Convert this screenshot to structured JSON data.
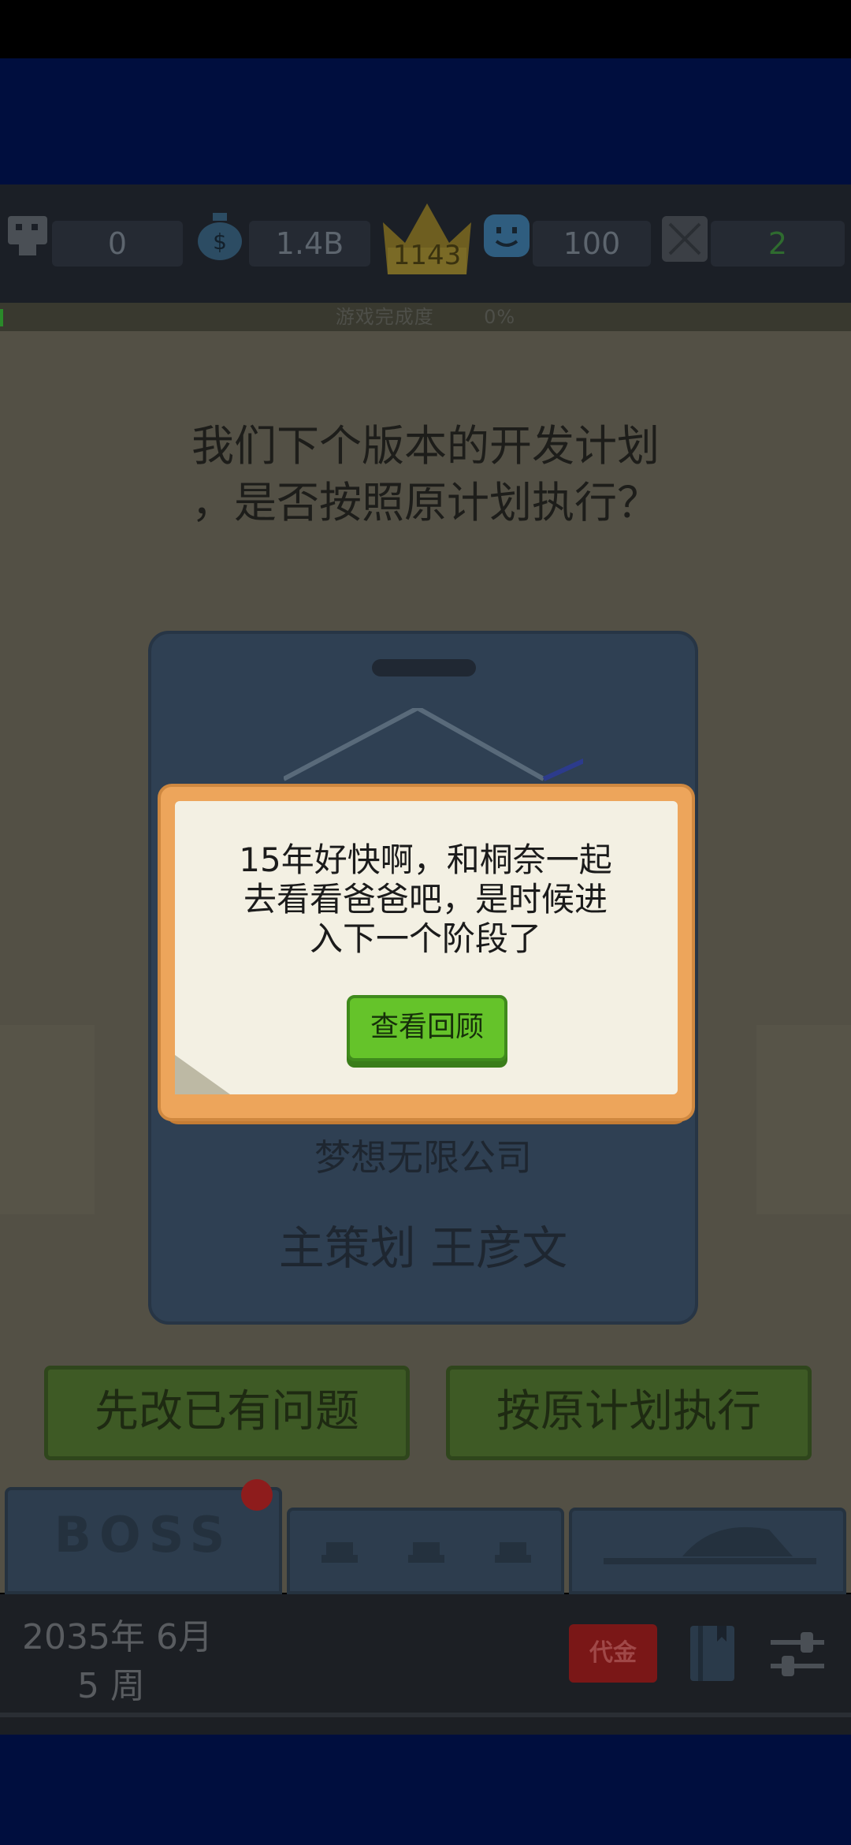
{
  "stats": {
    "fans": "0",
    "money": "1.4B",
    "crown_level": "1143",
    "happiness": "100",
    "bugs": "2"
  },
  "progress": {
    "label": "游戏完成度",
    "value": "0%"
  },
  "question": {
    "line1": "我们下个版本的开发计划",
    "line2": "，是否按照原计划执行？"
  },
  "badge": {
    "company": "梦想无限公司",
    "role": "主策划 王彦文"
  },
  "choices": {
    "left": "先改已有问题",
    "right": "按原计划执行"
  },
  "tabs": {
    "boss_label": "BOSS"
  },
  "date": {
    "year_month": "2035年 6月",
    "week": "5 周"
  },
  "coupon_label": "代金",
  "dialog": {
    "line1": "15年好快啊，和桐奈一起",
    "line2": "去看看爸爸吧，是时候进",
    "line3": "入下一个阶段了",
    "button_label": "查看回顾"
  },
  "colors": {
    "top_band": "#000e3e",
    "dialog_frame": "#eda55b",
    "dialog_paper": "#f3f0e3",
    "review_button": "#65c32a",
    "bug_count": "#2f6b2f"
  }
}
